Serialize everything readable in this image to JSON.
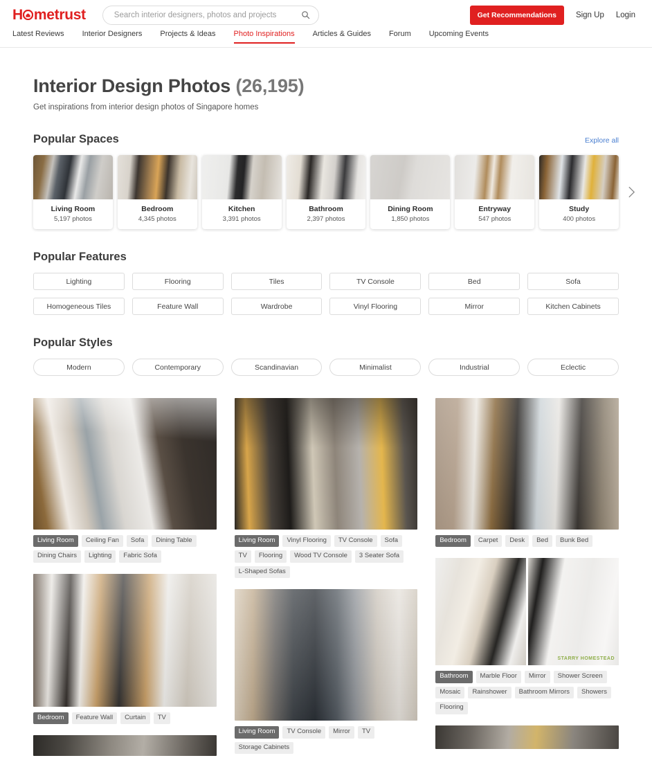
{
  "header": {
    "logo_text_1": "H",
    "logo_o": "house-o",
    "logo_text_2": "metrust",
    "search": {
      "placeholder": "Search interior designers, photos and projects",
      "value": "",
      "icon": "search-icon"
    },
    "cta_label": "Get Recommendations",
    "signup_label": "Sign Up",
    "login_label": "Login"
  },
  "nav": {
    "items": [
      {
        "label": "Latest Reviews",
        "active": false
      },
      {
        "label": "Interior Designers",
        "active": false
      },
      {
        "label": "Projects & Ideas",
        "active": false
      },
      {
        "label": "Photo Inspirations",
        "active": true
      },
      {
        "label": "Articles & Guides",
        "active": false
      },
      {
        "label": "Forum",
        "active": false
      },
      {
        "label": "Upcoming Events",
        "active": false
      }
    ]
  },
  "page": {
    "title": "Interior Design Photos",
    "count": "(26,195)",
    "subtitle": "Get inspirations from interior design photos of Singapore homes"
  },
  "popular_spaces": {
    "title": "Popular Spaces",
    "explore_all": "Explore all",
    "next_icon": "chevron-right-icon",
    "cards": [
      {
        "name": "Living Room",
        "count": "5,197 photos"
      },
      {
        "name": "Bedroom",
        "count": "4,345 photos"
      },
      {
        "name": "Kitchen",
        "count": "3,391 photos"
      },
      {
        "name": "Bathroom",
        "count": "2,397 photos"
      },
      {
        "name": "Dining Room",
        "count": "1,850 photos"
      },
      {
        "name": "Entryway",
        "count": "547 photos"
      },
      {
        "name": "Study",
        "count": "400 photos"
      }
    ]
  },
  "popular_features": {
    "title": "Popular Features",
    "items": [
      "Lighting",
      "Flooring",
      "Tiles",
      "TV Console",
      "Bed",
      "Sofa",
      "Homogeneous Tiles",
      "Feature Wall",
      "Wardrobe",
      "Vinyl Flooring",
      "Mirror",
      "Kitchen Cabinets"
    ]
  },
  "popular_styles": {
    "title": "Popular Styles",
    "items": [
      "Modern",
      "Contemporary",
      "Scandinavian",
      "Minimalist",
      "Industrial",
      "Eclectic"
    ]
  },
  "photo_grid": {
    "columns": [
      {
        "cards": [
          {
            "tags": [
              "Living Room",
              "Ceiling Fan",
              "Sofa",
              "Dining Table",
              "Dining Chairs",
              "Lighting",
              "Fabric Sofa"
            ]
          },
          {
            "tags": [
              "Bedroom",
              "Feature Wall",
              "Curtain",
              "TV"
            ]
          },
          {
            "tags": []
          }
        ]
      },
      {
        "cards": [
          {
            "tags": [
              "Living Room",
              "Vinyl Flooring",
              "TV Console",
              "Sofa",
              "TV",
              "Flooring",
              "Wood TV Console",
              "3 Seater Sofa",
              "L-Shaped Sofas"
            ]
          },
          {
            "tags": [
              "Living Room",
              "TV Console",
              "Mirror",
              "TV",
              "Storage Cabinets"
            ]
          }
        ]
      },
      {
        "cards": [
          {
            "tags": [
              "Bedroom",
              "Carpet",
              "Desk",
              "Bed",
              "Bunk Bed"
            ]
          },
          {
            "watermark": "STARRY HOMESTEAD",
            "tags": [
              "Bathroom",
              "Marble Floor",
              "Mirror",
              "Shower Screen",
              "Mosaic",
              "Rainshower",
              "Bathroom Mirrors",
              "Showers",
              "Flooring"
            ]
          },
          {
            "tags": []
          }
        ]
      }
    ]
  },
  "colors": {
    "brand_red": "#e02020",
    "link_blue": "#4a7fd0",
    "tag_bg": "#ededed",
    "tag_primary_bg": "#6b6b6b"
  }
}
